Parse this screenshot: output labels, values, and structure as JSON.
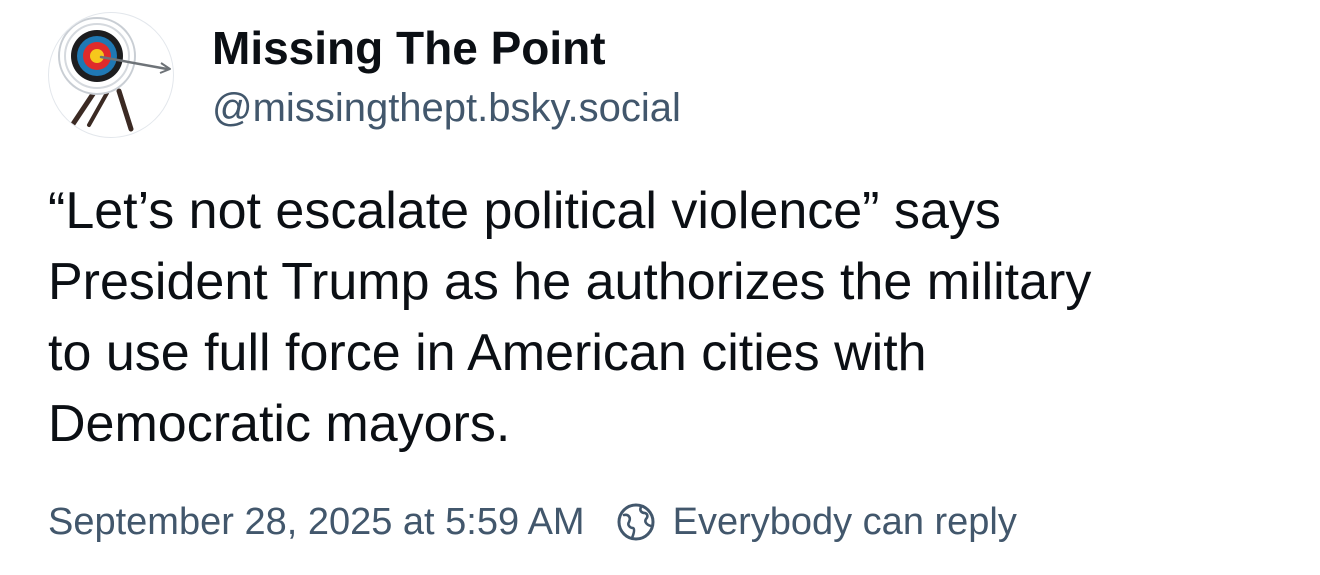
{
  "author": {
    "display_name": "Missing The Point",
    "handle": "@missingthept.bsky.social",
    "avatar_icon": "bullseye-target-icon"
  },
  "post": {
    "lines": [
      "“Let’s not escalate political violence” says",
      "President Trump as he authorizes the military",
      "to use full force in American cities with",
      "Democratic mayors."
    ]
  },
  "meta": {
    "timestamp": "September 28, 2025 at 5:59 AM",
    "reply_icon": "globe-icon",
    "reply_setting": "Everybody can reply"
  },
  "colors": {
    "text_primary": "#0b0f14",
    "text_secondary": "#42576c",
    "background": "#ffffff"
  }
}
